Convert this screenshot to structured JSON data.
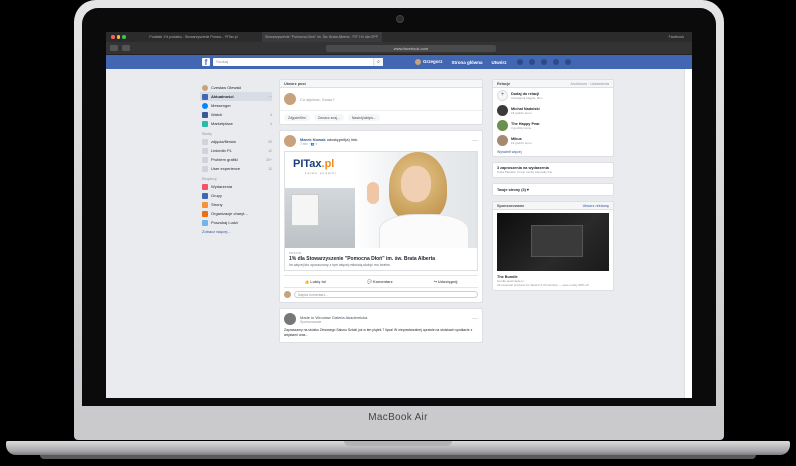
{
  "device": {
    "brand": "MacBook Air"
  },
  "browser": {
    "tabs": [
      "Podatek 1% podatku - Stowarzyszenie Pomoc... PITax.pl",
      "Stowarzyszenie \"Pomocna Dłoń\" im. Św. Brata Alberta - PIT 1% dla OPP"
    ],
    "new_tab": "Facebook",
    "url": "www.facebook.com"
  },
  "fb": {
    "search_placeholder": "Szukaj",
    "nav": {
      "profile": "Grzegorz",
      "home": "Strona główna",
      "create": "Utwórz"
    },
    "left": {
      "user": "Czesław Olewski",
      "items": [
        {
          "label": "Aktualności",
          "count": "···"
        },
        {
          "label": "Messenger",
          "count": ""
        },
        {
          "label": "Watch",
          "count": "4"
        },
        {
          "label": "Marketplace",
          "count": "4"
        }
      ],
      "shortcuts_title": "Skróty",
      "shortcuts": [
        {
          "label": "zdjęcia/filmów",
          "count": "20"
        },
        {
          "label": "Linkedin PL",
          "count": "12"
        },
        {
          "label": "Problem grafiki",
          "count": "20+"
        },
        {
          "label": "User experience",
          "count": "12"
        }
      ],
      "explore_title": "Eksploruj",
      "explore": [
        {
          "label": "Wydarzenia"
        },
        {
          "label": "Grupy"
        },
        {
          "label": "Strony"
        },
        {
          "label": "Organizacje charyt..."
        },
        {
          "label": "Poszukaj Ludzi"
        }
      ],
      "more": "Zobacz więcej..."
    },
    "composer": {
      "header": "Utwórz post",
      "placeholder": "Co słychać, Gosiu?",
      "buttons": [
        "Zdjęcie/film",
        "Oznacz znaj...",
        "Nastrój/aktyw..."
      ]
    },
    "post": {
      "author": "Marek Nowak",
      "action": "udostępnił(a) link.",
      "meta": "7 min · 👥 ▾",
      "logo_main": "PITax",
      "logo_accent": ".pl",
      "logo_tag": "Łatwe podatki",
      "domain": "PITAX.PL",
      "title": "1% dla Stowarzyszenie \"Pomocna Dłoń\" im. św. Brata Alberta",
      "desc": "Im więcej kto opuszczony z tym więcej miłością służyć mu trzeba",
      "like": "Lubię to!",
      "comment": "Komentarz",
      "share": "Udostępnij",
      "comment_placeholder": "Napisz komentarz..."
    },
    "post2": {
      "author": "Made in Wrocław Galeria Akademicka",
      "meta": "Sponsorowane",
      "text": "Zapraszamy na stoisko Zimowego Salonu Sztuki już w ten piątek 7 lipca! W niepowtarzalnej oprawie na stoiskach spotkacie z artystami oraz..."
    },
    "right": {
      "header_left": "Relacje",
      "header_right": "Archiwum · Ustawienia",
      "people": [
        {
          "name": "Dodaj do relacji",
          "sub": "Udostępnij zdjęcie, film..."
        },
        {
          "name": "Michał Nadolski",
          "sub": "18 godzin temu"
        },
        {
          "name": "The Happy Pear",
          "sub": "3 godziny temu"
        },
        {
          "name": "Mikus",
          "sub": "19 godzin temu"
        }
      ],
      "more": "Wyświetl więcej",
      "reminder": "3 zaproszenia na wydarzenia",
      "reminder_sub": "Kuba Plecała i 2 inne osoby zaprosiły Cię",
      "lang": "Twoje strony (3) ▾",
      "sponsored": "Sponsorowane",
      "create_ad": "Utwórz reklamę",
      "ad_title": "The Bundle",
      "ad_domain": "bundle.pixelmade.io",
      "ad_text": "All essential products for Sketch & Photoshop — save nearly 98% off"
    }
  }
}
